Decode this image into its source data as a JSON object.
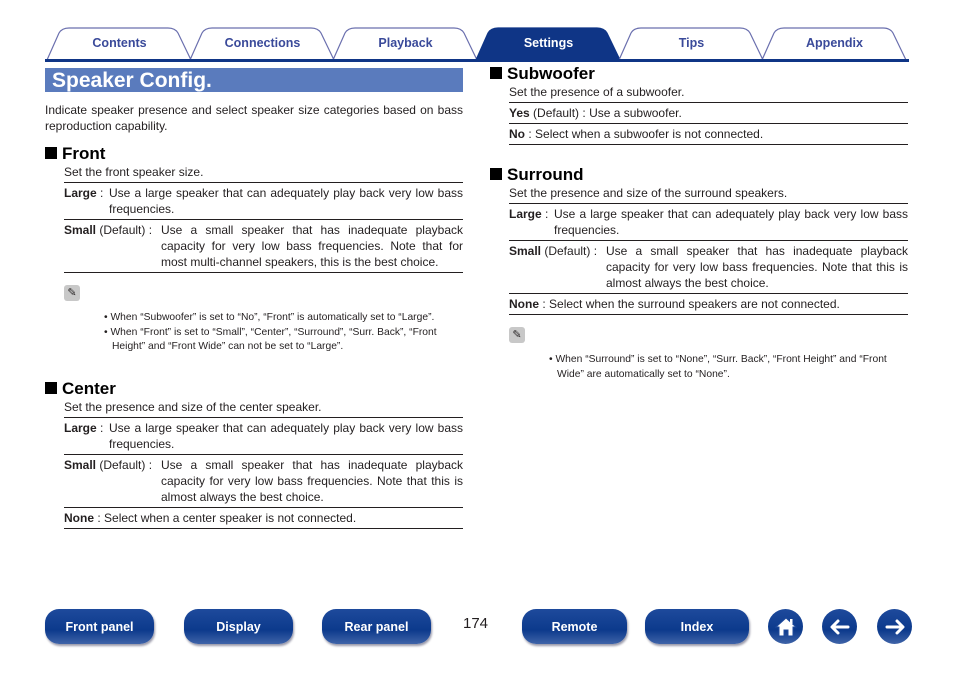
{
  "tabs": [
    {
      "label": "Contents",
      "active": false
    },
    {
      "label": "Connections",
      "active": false
    },
    {
      "label": "Playback",
      "active": false
    },
    {
      "label": "Settings",
      "active": true
    },
    {
      "label": "Tips",
      "active": false
    },
    {
      "label": "Appendix",
      "active": false
    }
  ],
  "colors": {
    "tab_active": "#0f3586",
    "tab_outline": "#6a6fae",
    "title_bar": "#5a7bbd",
    "button": "#0c3a8c"
  },
  "title": "Speaker Config.",
  "intro": "Indicate speaker presence and select speaker size categories based on bass reproduction capability.",
  "front": {
    "heading": "Front",
    "desc": "Set the front speaker size.",
    "rows": [
      {
        "term": "Large",
        "suffix": " : ",
        "text": "Use a large speaker that can adequately play back very low bass frequencies."
      },
      {
        "term": "Small",
        "suffix": " (Default) : ",
        "text": "Use a small speaker that has inadequate playback capacity for very low bass frequencies. Note that for most multi-channel speakers, this is the best choice."
      }
    ],
    "notes": [
      "• When “Subwoofer” is set to “No”, “Front” is automatically set to “Large”.",
      "• When “Front” is set to “Small”, “Center”, “Surround”, “Surr. Back”, “Front Height” and “Front Wide” can not be set to “Large”."
    ]
  },
  "center": {
    "heading": "Center",
    "desc": "Set the presence and size of the center speaker.",
    "rows": [
      {
        "term": "Large",
        "suffix": " : ",
        "text": "Use a large speaker that can adequately play back very low bass frequencies."
      },
      {
        "term": "Small",
        "suffix": " (Default) : ",
        "text": "Use a small speaker that has inadequate playback capacity for very low bass frequencies. Note that this is almost always the best choice."
      },
      {
        "term": "None",
        "suffix": " : ",
        "text": "Select when a center speaker is not connected."
      }
    ]
  },
  "subwoofer": {
    "heading": "Subwoofer",
    "desc": "Set the presence of a subwoofer.",
    "rows": [
      {
        "term": "Yes",
        "suffix": " (Default) : ",
        "text": "Use a subwoofer."
      },
      {
        "term": "No",
        "suffix": " : ",
        "text": "Select when a subwoofer is not connected."
      }
    ]
  },
  "surround": {
    "heading": "Surround",
    "desc": "Set the presence and size of the surround speakers.",
    "rows": [
      {
        "term": "Large",
        "suffix": " : ",
        "text": "Use a large speaker that can adequately play back very low bass frequencies."
      },
      {
        "term": "Small",
        "suffix": " (Default) : ",
        "text": "Use a small speaker that has inadequate playback capacity for very low bass frequencies. Note that this is almost always the best choice."
      },
      {
        "term": "None",
        "suffix": " : ",
        "text": "Select when the surround speakers are not connected."
      }
    ],
    "notes": [
      "• When “Surround” is set to “None”, “Surr. Back”, “Front Height” and “Front Wide” are automatically set to “None”."
    ]
  },
  "footer": {
    "page_number": "174",
    "buttons": [
      "Front panel",
      "Display",
      "Rear panel",
      "Remote",
      "Index"
    ],
    "icons": [
      "home-icon",
      "back-arrow-icon",
      "forward-arrow-icon"
    ]
  }
}
